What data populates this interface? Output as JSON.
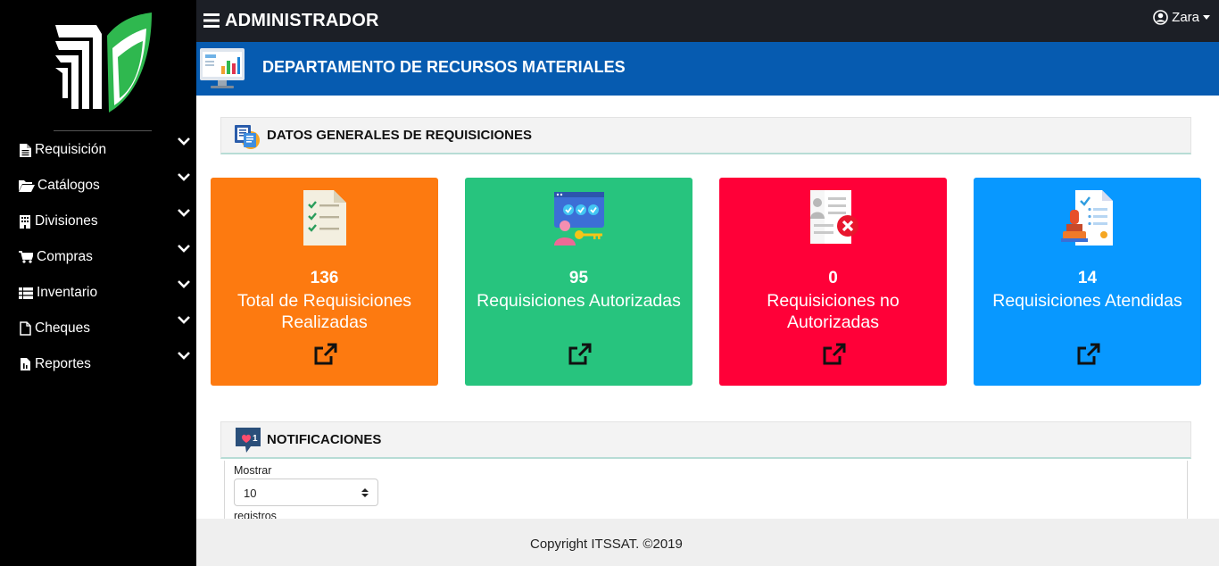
{
  "topbar": {
    "title": "ADMINISTRADOR",
    "user": "Zara"
  },
  "sidebar": {
    "items": [
      {
        "label": "Requisición",
        "icon": "file-icon"
      },
      {
        "label": "Catálogos",
        "icon": "folder-open-icon"
      },
      {
        "label": "Divisiones",
        "icon": "building-icon"
      },
      {
        "label": "Compras",
        "icon": "shopping-cart-icon"
      },
      {
        "label": "Inventario",
        "icon": "table-list-icon"
      },
      {
        "label": "Cheques",
        "icon": "file-outline-icon"
      },
      {
        "label": "Reportes",
        "icon": "file-report-icon"
      }
    ]
  },
  "header": {
    "department": "DEPARTAMENTO DE RECURSOS MATERIALES"
  },
  "summary": {
    "title": "DATOS GENERALES DE REQUISICIONES",
    "cards": [
      {
        "value": "136",
        "label": "Total de Requisiciones Realizadas",
        "color": "#fd7a10"
      },
      {
        "value": "95",
        "label": "Requisiciones Autorizadas",
        "color": "#27c47e"
      },
      {
        "value": "0",
        "label": "Requisiciones no Autorizadas",
        "color": "#ff0038"
      },
      {
        "value": "14",
        "label": "Requisiciones Atendidas",
        "color": "#0898ff"
      }
    ]
  },
  "notifications": {
    "title": "NOTIFICACIONES",
    "badge": "1",
    "show_label": "Mostrar",
    "page_size": "10",
    "records_label": "registros"
  },
  "footer": {
    "text": "Copyright ITSSAT. ©2019"
  },
  "colors": {
    "sidebar": "#000000",
    "topbar": "#1c1f26",
    "header": "#065bb0"
  }
}
